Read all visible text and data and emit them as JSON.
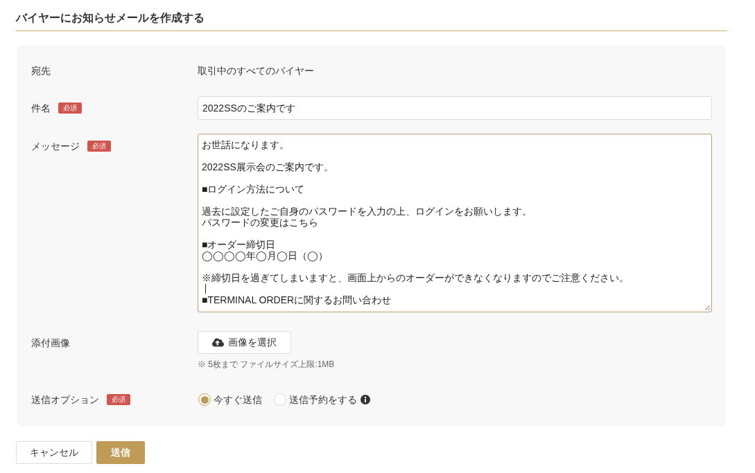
{
  "page_title": "バイヤーにお知らせメールを作成する",
  "form": {
    "recipient": {
      "label": "宛先",
      "value": "取引中のすべてのバイヤー"
    },
    "subject": {
      "label": "件名",
      "badge": "必須",
      "value": "2022SSのご案内です"
    },
    "message": {
      "label": "メッセージ",
      "badge": "必須",
      "focused": true,
      "lines": [
        {
          "kind": "text",
          "text": "お世話になります。"
        },
        {
          "kind": "blank"
        },
        {
          "kind": "text",
          "text": "2022SS展示会のご案内です。"
        },
        {
          "kind": "blank"
        },
        {
          "kind": "text",
          "text": "■ログイン方法について"
        },
        {
          "kind": "blank"
        },
        {
          "kind": "text",
          "text": "過去に設定したご自身のパスワードを入力の上、ログインをお願いします。"
        },
        {
          "kind": "text",
          "text": "パスワードの変更はこちら"
        },
        {
          "kind": "blank"
        },
        {
          "kind": "text",
          "text": "■オーダー締切日"
        },
        {
          "kind": "text",
          "text": "◯◯◯◯年◯月◯日（◯）"
        },
        {
          "kind": "blank"
        },
        {
          "kind": "text",
          "text": "※締切日を過ぎてしまいますと、画面上からのオーダーができなくなりますのでご注意ください。"
        },
        {
          "kind": "caret"
        },
        {
          "kind": "text",
          "text": "■TERMINAL ORDERに関するお問い合わせ"
        }
      ]
    },
    "attachment": {
      "label": "添付画像",
      "button": "画像を選択",
      "hint": "※ 5枚まで ファイルサイズ上限:1MB"
    },
    "send_option": {
      "label": "送信オプション",
      "badge": "必須",
      "options": [
        {
          "label": "今すぐ送信",
          "selected": true,
          "info": false
        },
        {
          "label": "送信予約をする",
          "selected": false,
          "info": true
        }
      ]
    }
  },
  "buttons": [
    {
      "label": "キャンセル",
      "kind": "secondary"
    },
    {
      "label": "送信",
      "kind": "primary"
    }
  ]
}
